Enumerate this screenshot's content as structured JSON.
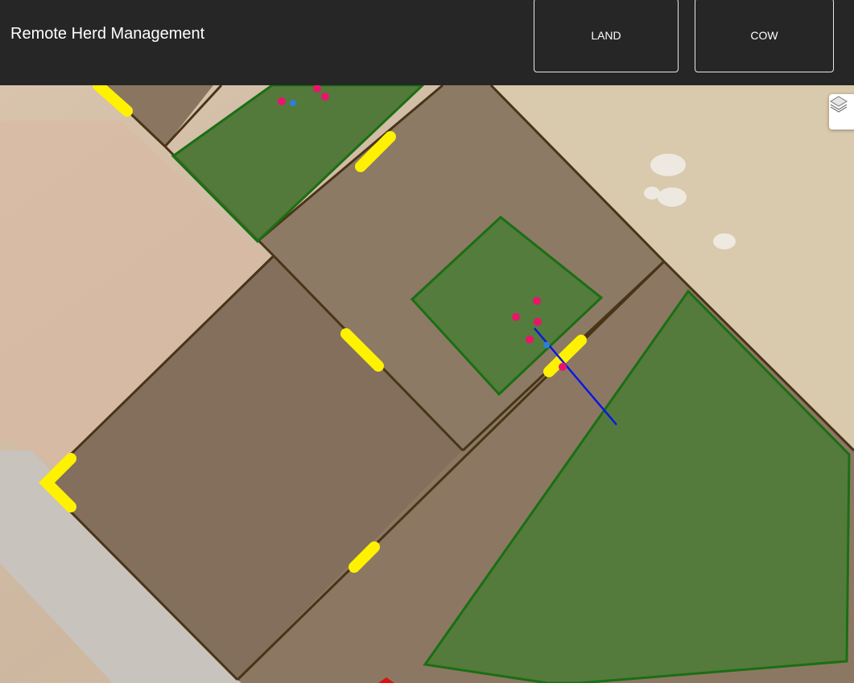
{
  "app": {
    "title": "Remote Herd Management"
  },
  "nav": {
    "land_label": "LAND",
    "cow_label": "COW"
  },
  "map": {
    "layers_icon": "layers-icon",
    "colors": {
      "paddock_border": "#4a3418",
      "pasture_fill": "#3f7d2c",
      "pasture_border": "#1b6e14",
      "gate": "#fff200",
      "cow_marker": "#e8166b",
      "device_marker": "#2f7fd6",
      "track_line": "#0a18e6"
    }
  }
}
